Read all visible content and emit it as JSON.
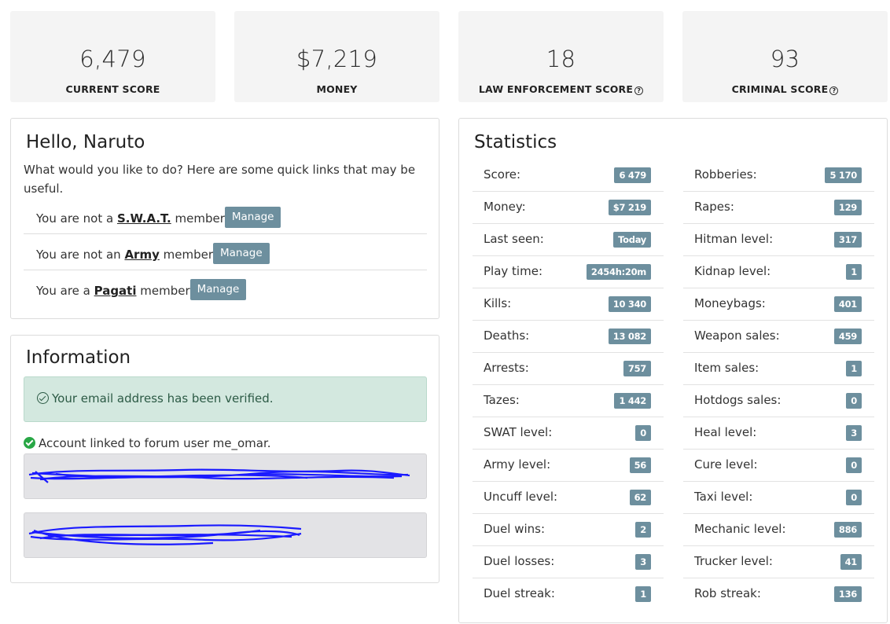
{
  "summary_cards": [
    {
      "value": "6,479",
      "label": "CURRENT SCORE",
      "help": false
    },
    {
      "value": "$7,219",
      "label": "MONEY",
      "help": false
    },
    {
      "value": "18",
      "label": "LAW ENFORCEMENT SCORE",
      "help": true
    },
    {
      "value": "93",
      "label": "CRIMINAL SCORE",
      "help": true
    }
  ],
  "hello": {
    "title": "Hello, Naruto",
    "intro": "What would you like to do? Here are some quick links that may be useful.",
    "memberships": [
      {
        "prefix": "You are not a ",
        "group": "S.W.A.T.",
        "suffix": " member",
        "button": "Manage"
      },
      {
        "prefix": "You are not an ",
        "group": "Army",
        "suffix": " member",
        "button": "Manage"
      },
      {
        "prefix": "You are a ",
        "group": "Pagati",
        "suffix": " member",
        "button": "Manage"
      }
    ]
  },
  "information": {
    "title": "Information",
    "verified_text": "Your email address has been verified.",
    "linked_text": "Account linked to forum user me_omar."
  },
  "statistics": {
    "title": "Statistics",
    "left": [
      {
        "name": "Score:",
        "value": "6 479"
      },
      {
        "name": "Money:",
        "value": "$7 219"
      },
      {
        "name": "Last seen:",
        "value": "Today"
      },
      {
        "name": "Play time:",
        "value": "2454h:20m"
      },
      {
        "name": "Kills:",
        "value": "10 340"
      },
      {
        "name": "Deaths:",
        "value": "13 082"
      },
      {
        "name": "Arrests:",
        "value": "757"
      },
      {
        "name": "Tazes:",
        "value": "1 442"
      },
      {
        "name": "SWAT level:",
        "value": "0"
      },
      {
        "name": "Army level:",
        "value": "56"
      },
      {
        "name": "Uncuff level:",
        "value": "62"
      },
      {
        "name": "Duel wins:",
        "value": "2"
      },
      {
        "name": "Duel losses:",
        "value": "3"
      },
      {
        "name": "Duel streak:",
        "value": "1"
      }
    ],
    "right": [
      {
        "name": "Robberies:",
        "value": "5 170"
      },
      {
        "name": "Rapes:",
        "value": "129"
      },
      {
        "name": "Hitman level:",
        "value": "317"
      },
      {
        "name": "Kidnap level:",
        "value": "1"
      },
      {
        "name": "Moneybags:",
        "value": "401"
      },
      {
        "name": "Weapon sales:",
        "value": "459"
      },
      {
        "name": "Item sales:",
        "value": "1"
      },
      {
        "name": "Hotdogs sales:",
        "value": "0"
      },
      {
        "name": "Heal level:",
        "value": "3"
      },
      {
        "name": "Cure level:",
        "value": "0"
      },
      {
        "name": "Taxi level:",
        "value": "0"
      },
      {
        "name": "Mechanic level:",
        "value": "886"
      },
      {
        "name": "Trucker level:",
        "value": "41"
      },
      {
        "name": "Rob streak:",
        "value": "136"
      }
    ]
  },
  "colors": {
    "badge": "#6d8f9e",
    "card_bg": "#f4f4f4",
    "verified_bg": "#d3e8df",
    "scribble": "#1a1aff"
  }
}
